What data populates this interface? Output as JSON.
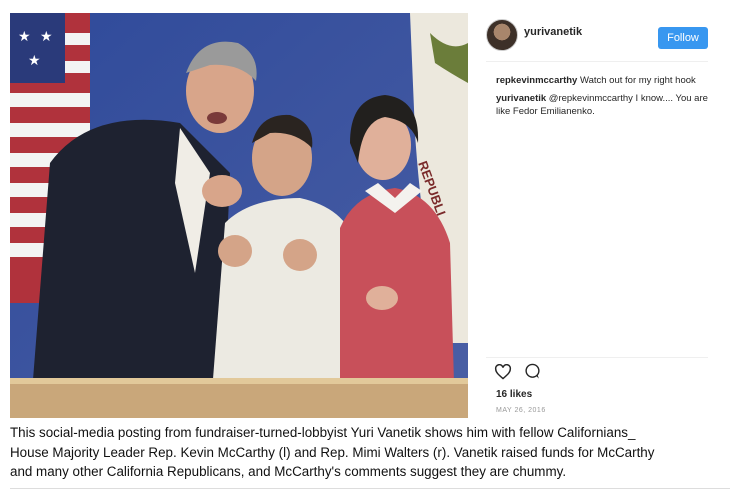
{
  "post": {
    "username": "yurivanetik",
    "follow_label": "Follow",
    "comments": [
      {
        "user": "repkevinmccarthy",
        "text": " Watch out for my right hook"
      },
      {
        "user": "yurivanetik",
        "text": " @repkevinmccarthy I know.... You are like Fedor Emilianenko."
      }
    ],
    "photo_flag_text": "REPUBLI",
    "likes": "16 likes",
    "date": "MAY 26, 2016"
  },
  "icons": {
    "like": "heart-outline-icon",
    "comment": "speech-bubble-icon"
  },
  "colors": {
    "follow_button": "#3897f0",
    "backdrop": "#3a4f8f"
  },
  "caption": {
    "lines": [
      "This social-media posting from fundraiser-turned-lobbyist Yuri Vanetik shows him with fellow Californians_",
      "House Majority Leader Rep. Kevin McCarthy (l) and Rep. Mimi Walters (r). Vanetik raised funds for McCarthy",
      "and many other California Republicans, and McCarthy's comments suggest they are chummy."
    ]
  }
}
